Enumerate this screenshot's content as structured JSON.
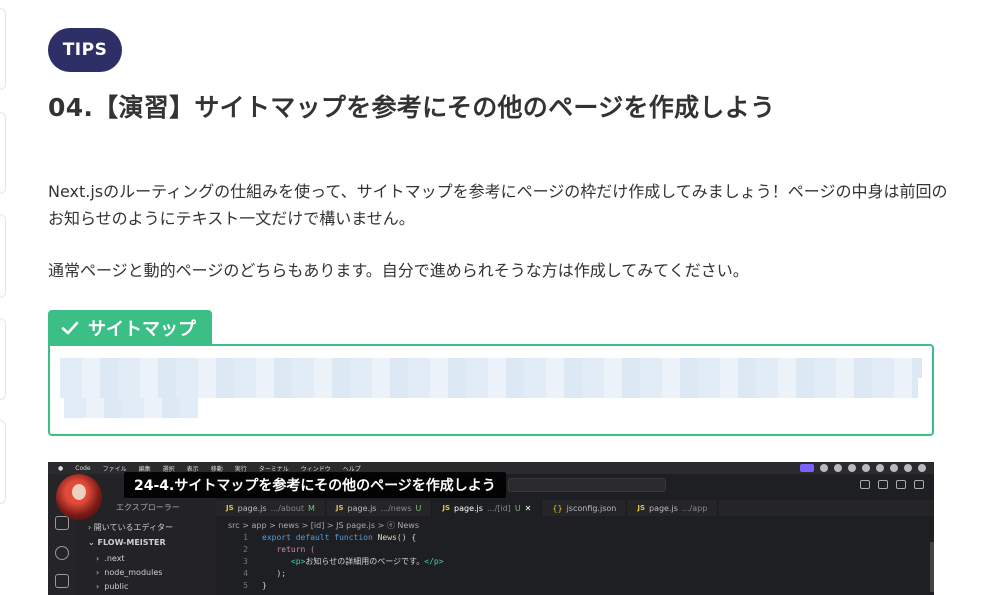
{
  "badge": {
    "label": "TIPS"
  },
  "title": "04.【演習】サイトマップを参考にその他のページを作成しよう",
  "paragraphs": {
    "p1": "Next.jsのルーティングの仕組みを使って、サイトマップを参考にページの枠だけ作成してみましょう！ページの中身は前回のお知らせのようにテキスト一文だけで構いません。",
    "p2": "通常ページと動的ページのどちらもあります。自分で進められそうな方は作成してみてください。"
  },
  "sitemap": {
    "label": "サイトマップ",
    "icon": "check-icon",
    "accent": "#3bbf86"
  },
  "video": {
    "title": "24-4.サイトマップを参考にその他のページを作成しよう",
    "menubar": [
      "Code",
      "ファイル",
      "編集",
      "選択",
      "表示",
      "移動",
      "実行",
      "ターミナル",
      "ウィンドウ",
      "ヘルプ"
    ],
    "explorer": {
      "header": "エクスプローラー",
      "open_editors": "開いているエディター",
      "project": "FLOW-MEISTER",
      "items": [
        ".next",
        "node_modules",
        "public"
      ]
    },
    "tabs": [
      {
        "file": "page.js",
        "path": ".../about",
        "status": "M"
      },
      {
        "file": "page.js",
        "path": ".../news",
        "status": "U"
      },
      {
        "file": "page.js",
        "path": ".../[id]",
        "status": "U",
        "active": true
      },
      {
        "file": "jsconfig.json",
        "path": "",
        "status": ""
      },
      {
        "file": "page.js",
        "path": ".../app",
        "status": ""
      }
    ],
    "breadcrumb": "src > app > news > [id] > JS page.js > ⓔ News",
    "code": {
      "line1": {
        "n": "1",
        "kw": "export default function",
        "fn": "News",
        "rest": "() {"
      },
      "line2": {
        "n": "2",
        "text": "return ("
      },
      "line3": {
        "n": "3",
        "open": "<p>",
        "text": "お知らせの詳細用のページです。",
        "close": "</p>"
      },
      "line4": {
        "n": "4",
        "text": ");"
      },
      "line5": {
        "n": "5",
        "text": "}"
      }
    }
  },
  "colors": {
    "badge_bg": "#2e2f66",
    "green": "#3bbf86",
    "editor_bg": "#1e1f22"
  }
}
